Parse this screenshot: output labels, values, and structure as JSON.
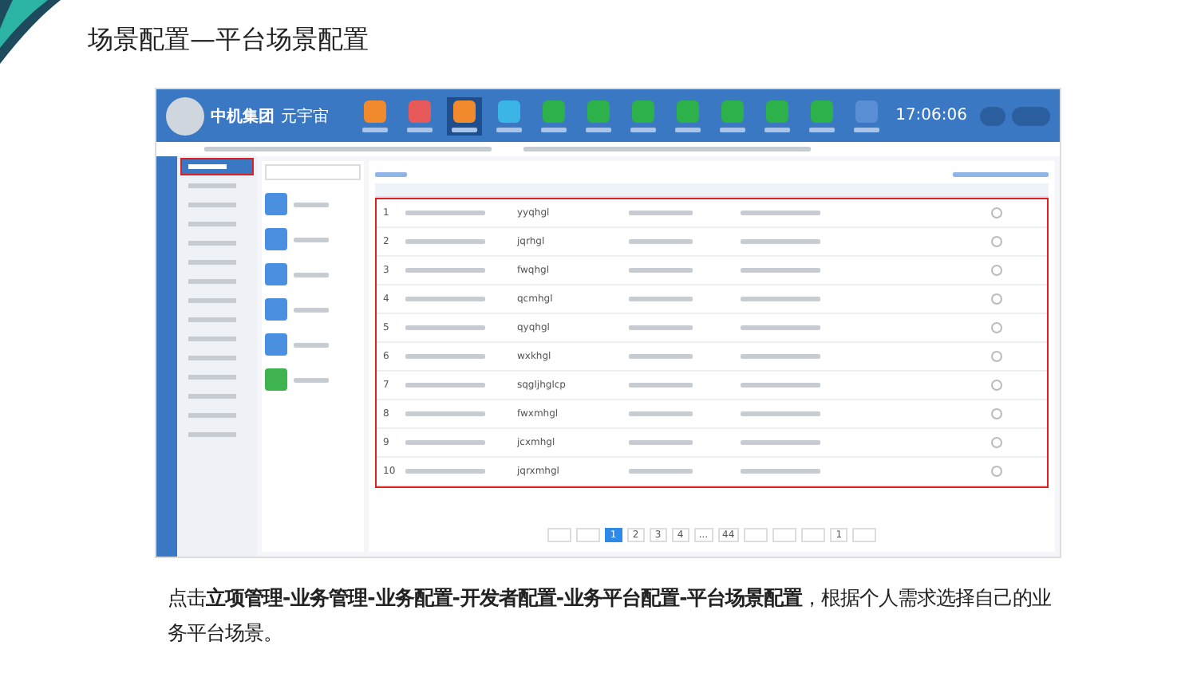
{
  "title": "场景配置—平台场景配置",
  "screenshot": {
    "brand_name": "中机集团",
    "brand_sub": "元宇宙",
    "clock": "17:06:06",
    "nav_icons": [
      {
        "color": "#f08a2c",
        "selected": false
      },
      {
        "color": "#e85a5a",
        "selected": false
      },
      {
        "color": "#f08a2c",
        "selected": true
      },
      {
        "color": "#3bb4e6",
        "selected": false
      },
      {
        "color": "#2db14a",
        "selected": false
      },
      {
        "color": "#2db14a",
        "selected": false
      },
      {
        "color": "#2db14a",
        "selected": false
      },
      {
        "color": "#2db14a",
        "selected": false
      },
      {
        "color": "#2db14a",
        "selected": false
      },
      {
        "color": "#2db14a",
        "selected": false
      },
      {
        "color": "#2db14a",
        "selected": false
      },
      {
        "color": "#5a8fd6",
        "selected": false
      }
    ],
    "sidebar_items": [
      {
        "selected": true
      },
      {
        "selected": false
      },
      {
        "selected": false
      },
      {
        "selected": false
      },
      {
        "selected": false
      },
      {
        "selected": false
      },
      {
        "selected": false
      },
      {
        "selected": false
      },
      {
        "selected": false
      },
      {
        "selected": false
      },
      {
        "selected": false
      },
      {
        "selected": false
      },
      {
        "selected": false
      },
      {
        "selected": false
      },
      {
        "selected": false
      }
    ],
    "app_tiles": [
      {
        "color": "#4a8fe0"
      },
      {
        "color": "#4a8fe0"
      },
      {
        "color": "#4a8fe0"
      },
      {
        "color": "#4a8fe0"
      },
      {
        "color": "#4a8fe0"
      },
      {
        "color": "#3fb34f"
      }
    ],
    "rows": [
      {
        "number": "1",
        "code": "yyqhgl",
        "selected": false
      },
      {
        "number": "2",
        "code": "jqrhgl",
        "selected": false
      },
      {
        "number": "3",
        "code": "fwqhgl",
        "selected": false
      },
      {
        "number": "4",
        "code": "qcmhgl",
        "selected": false
      },
      {
        "number": "5",
        "code": "qyqhgl",
        "selected": false
      },
      {
        "number": "6",
        "code": "wxkhgl",
        "selected": false
      },
      {
        "number": "7",
        "code": "sqgljhglcp",
        "selected": false
      },
      {
        "number": "8",
        "code": "fwxmhgl",
        "selected": false
      },
      {
        "number": "9",
        "code": "jcxmhgl",
        "selected": false
      },
      {
        "number": "10",
        "code": "jqrxmhgl",
        "selected": false
      }
    ],
    "pages": [
      {
        "label": "1",
        "selected": true
      },
      {
        "label": "2",
        "selected": false
      },
      {
        "label": "3",
        "selected": false
      },
      {
        "label": "4",
        "selected": false
      },
      {
        "label": "...",
        "selected": false
      },
      {
        "label": "44",
        "selected": false
      }
    ],
    "goto_value": "1"
  },
  "caption": "点击**立项管理-业务管理-业务配置-开发者配置-业务平台配置-平台场景配置**，根据个人需求选择自己的业务平台场景。"
}
